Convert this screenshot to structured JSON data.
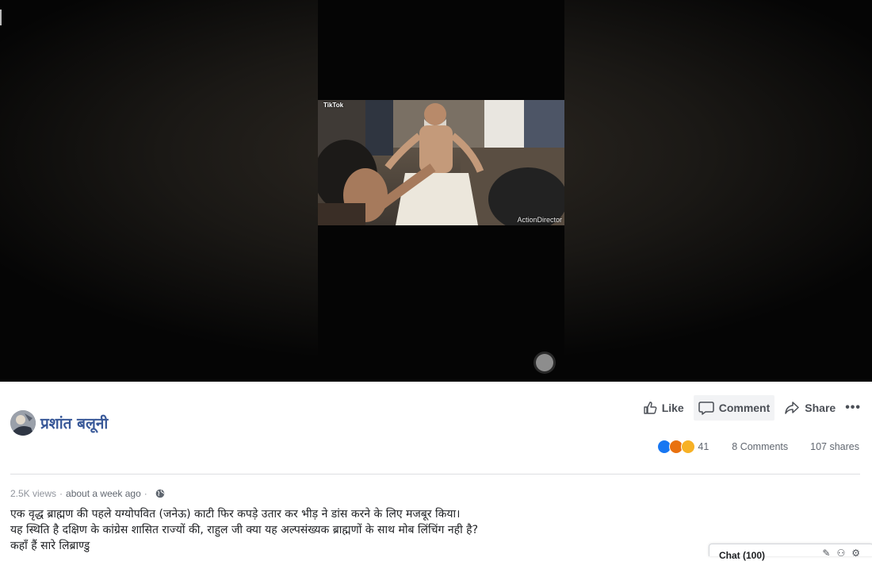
{
  "video": {
    "tiktok_label": "TikTok",
    "watermark": "ActionDirector"
  },
  "post": {
    "author": "प्रशांत बलूनी",
    "views": "2.5K views",
    "time": "about a week ago",
    "description": [
      "एक वृद्ध ब्राह्मण की पहले यग्योपवित (जनेऊ) काटी फिर कपड़े उतार कर भीड़ ने डांस करने के लिए मजबूर किया।",
      "यह स्थिति है दक्षिण के कांग्रेस शासित राज्यों की, राहुल जी क्या यह अल्पसंख्यक ब्राह्मणों के साथ मोब लिंचिंग नही है?",
      "कहाँ हैं सारे लिब्राण्डु"
    ]
  },
  "actions": {
    "like": "Like",
    "comment": "Comment",
    "share": "Share",
    "more": "•••"
  },
  "stats": {
    "reactions": "41",
    "comments": "8 Comments",
    "shares": "107 shares"
  },
  "chat": {
    "label": "Chat (100)"
  },
  "colors": {
    "link": "#385898",
    "like_reaction": "#1877f2",
    "angry_reaction": "#e9710f",
    "sad_reaction": "#f7b125"
  }
}
